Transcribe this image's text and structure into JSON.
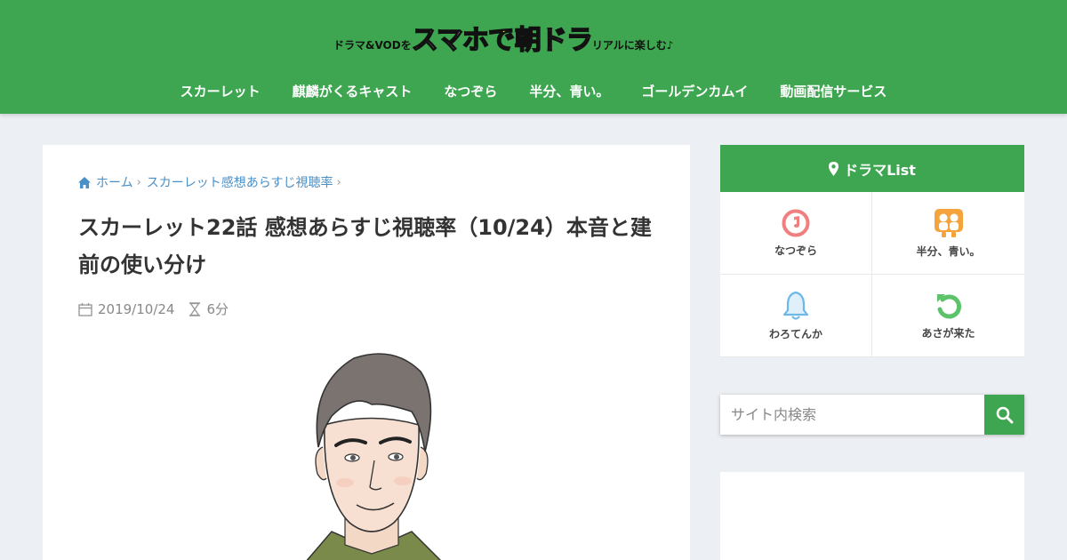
{
  "header": {
    "logo": {
      "part1": "ドラマ&VODを",
      "part2": "スマホ",
      "part3": "で",
      "part4": "朝ドラ",
      "part5": "リアルに楽しむ♪"
    },
    "nav": [
      "スカーレット",
      "麒麟がくるキャスト",
      "なつぞら",
      "半分、青い。",
      "ゴールデンカムイ",
      "動画配信サービス"
    ]
  },
  "article": {
    "breadcrumb": [
      "ホーム",
      "スカーレット感想あらすじ視聴率"
    ],
    "title": "スカーレット22話 感想あらすじ視聴率（10/24）本音と建前の使い分け",
    "date": "2019/10/24",
    "read_time": "6分"
  },
  "sidebar": {
    "list_title": "ドラマList",
    "items": [
      {
        "label": "なつぞら",
        "icon": "music-disc-icon",
        "color": "#f08080"
      },
      {
        "label": "半分、青い。",
        "icon": "people-icon",
        "color": "#f5a33c"
      },
      {
        "label": "わろてんか",
        "icon": "bell-icon",
        "color": "#6cb8e8"
      },
      {
        "label": "あさが来た",
        "icon": "undo-icon",
        "color": "#5cc36a"
      }
    ],
    "search_placeholder": "サイト内検索"
  },
  "colors": {
    "brand": "#3ea650",
    "link": "#4a90c8"
  }
}
